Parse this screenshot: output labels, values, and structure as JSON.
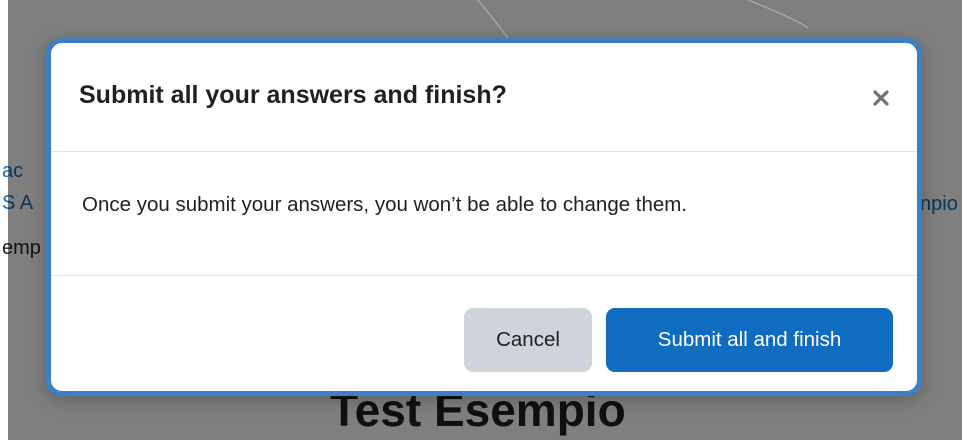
{
  "background_page": {
    "left_fragments": [
      "ac",
      "S A",
      "emp"
    ],
    "right_fragment": "npio",
    "heading": "Test Esempio"
  },
  "modal": {
    "title": "Submit all your answers and finish?",
    "close_icon": "close-icon",
    "message": "Once you submit your answers, you won’t be able to change them.",
    "cancel_label": "Cancel",
    "submit_label": "Submit all and finish"
  },
  "colors": {
    "primary": "#0f6cbf",
    "secondary_button": "#ced4da",
    "modal_border": "#3d7fc4",
    "text": "#1d2125"
  }
}
